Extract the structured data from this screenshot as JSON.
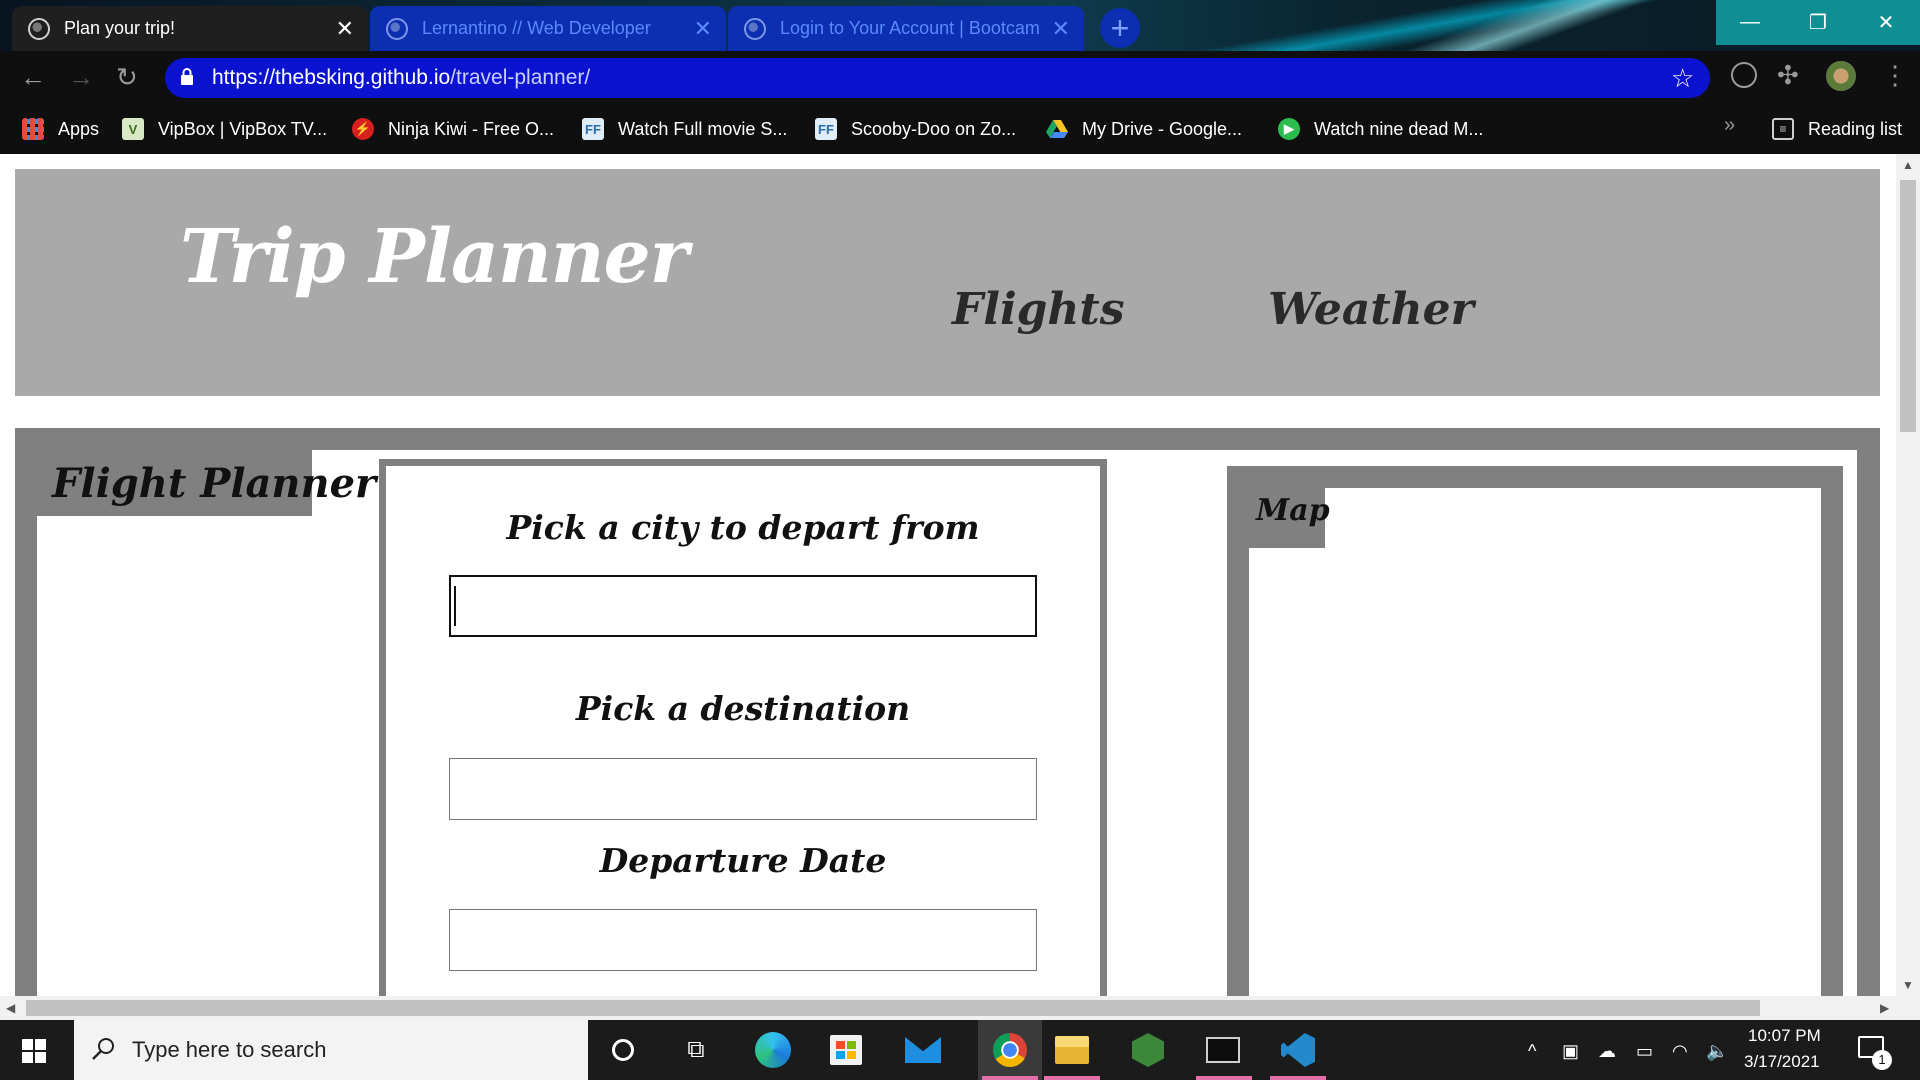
{
  "browser": {
    "tabs": [
      {
        "title": "Plan your trip!",
        "active": true
      },
      {
        "title": "Lernantino // Web Developer",
        "active": false
      },
      {
        "title": "Login to Your Account | Bootcam",
        "active": false
      }
    ],
    "new_tab_glyph": "+",
    "window_controls": {
      "minimize": "—",
      "restore": "❐",
      "close": "✕"
    },
    "url_host": "https://thebsking.github.io",
    "url_path": "/travel-planner/",
    "bookmarks": [
      {
        "label": "Apps",
        "icon": "apps-grid-icon"
      },
      {
        "label": "VipBox | VipBox TV...",
        "icon": "vipbox-icon"
      },
      {
        "label": "Ninja Kiwi - Free O...",
        "icon": "ninja-kiwi-icon"
      },
      {
        "label": "Watch Full movie S...",
        "icon": "movie-site-icon"
      },
      {
        "label": "Scooby-Doo on Zo...",
        "icon": "movie-site-icon"
      },
      {
        "label": "My Drive - Google...",
        "icon": "google-drive-icon"
      },
      {
        "label": "Watch nine dead M...",
        "icon": "movie-play-icon"
      }
    ],
    "more_bookmarks_glyph": "»",
    "reading_list": "Reading list",
    "accent_colors": {
      "omnibox": "#0c13d0",
      "inactive_tab": "#0b2fb0",
      "window_controls": "#0f8f94"
    }
  },
  "page": {
    "site_title": "Trip Planner",
    "nav": [
      "Flights",
      "Weather"
    ],
    "flight_section_title": "Flight Planner",
    "form": {
      "depart_label": "Pick a city to depart from",
      "depart_value": "",
      "destination_label": "Pick a destination",
      "destination_value": "",
      "date_label": "Departure Date",
      "date_value": ""
    },
    "map_title": "Map",
    "colors": {
      "header_bg": "#a9a9a9",
      "frame_gray": "#808080",
      "title_white": "#ffffff",
      "text_dark": "#111111"
    }
  },
  "taskbar": {
    "search_placeholder": "Type here to search",
    "time": "10:07 PM",
    "date": "3/17/2021",
    "notification_count": "1",
    "pinned": [
      "cortana-icon",
      "task-view-icon",
      "edge-icon",
      "store-icon",
      "mail-icon",
      "chrome-icon",
      "file-explorer-icon",
      "node-icon",
      "terminal-icon",
      "vscode-icon"
    ]
  }
}
